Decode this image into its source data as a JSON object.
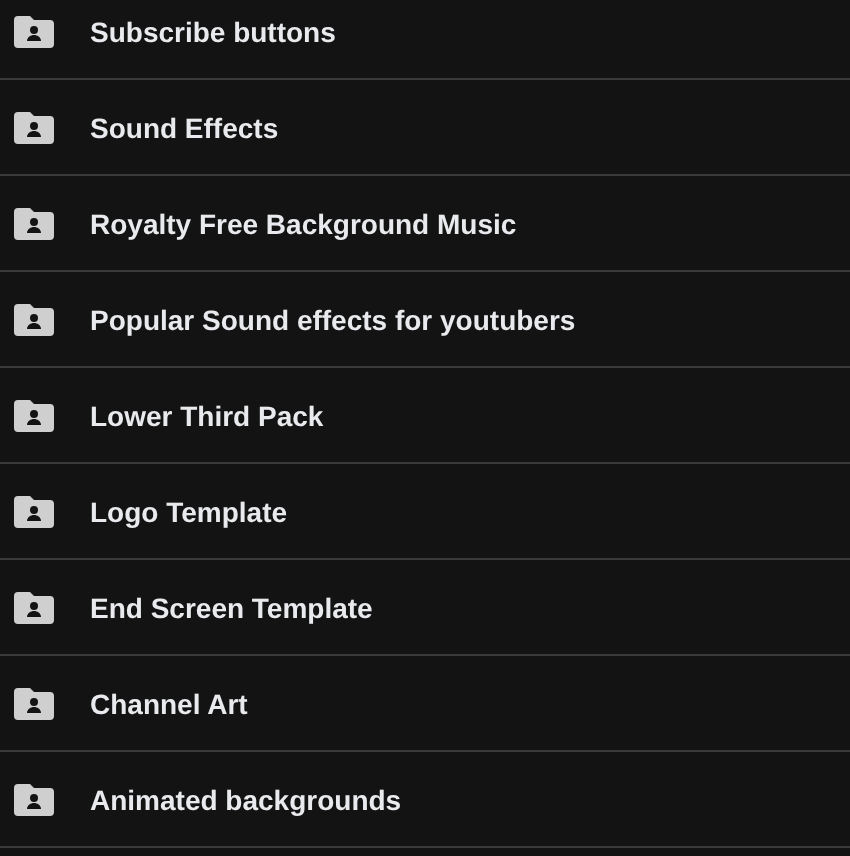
{
  "folders": [
    {
      "name": "Subscribe buttons"
    },
    {
      "name": "Sound Effects"
    },
    {
      "name": "Royalty Free Background Music"
    },
    {
      "name": "Popular Sound effects for youtubers"
    },
    {
      "name": "Lower Third Pack"
    },
    {
      "name": "Logo Template"
    },
    {
      "name": "End Screen Template"
    },
    {
      "name": "Channel Art"
    },
    {
      "name": "Animated backgrounds"
    }
  ]
}
